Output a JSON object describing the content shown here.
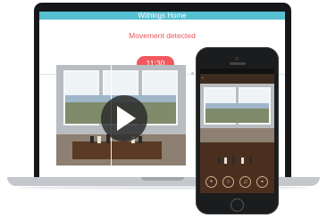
{
  "laptop": {
    "window_title": "Withings Home",
    "alert": "Movement detected",
    "time": "11:30",
    "play_icon": "play-icon"
  },
  "phone": {
    "status": "",
    "app_title": "",
    "tools": [
      {
        "icon": "chat-icon",
        "glyph": "💬"
      },
      {
        "icon": "bulb-icon",
        "glyph": "💡"
      },
      {
        "icon": "music-icon",
        "glyph": "♫"
      },
      {
        "icon": "camera-icon",
        "glyph": "📷"
      }
    ]
  },
  "colors": {
    "app_bar": "#56c0d0",
    "accent": "#f1595f",
    "phone_wood": "#4a2f1f"
  }
}
